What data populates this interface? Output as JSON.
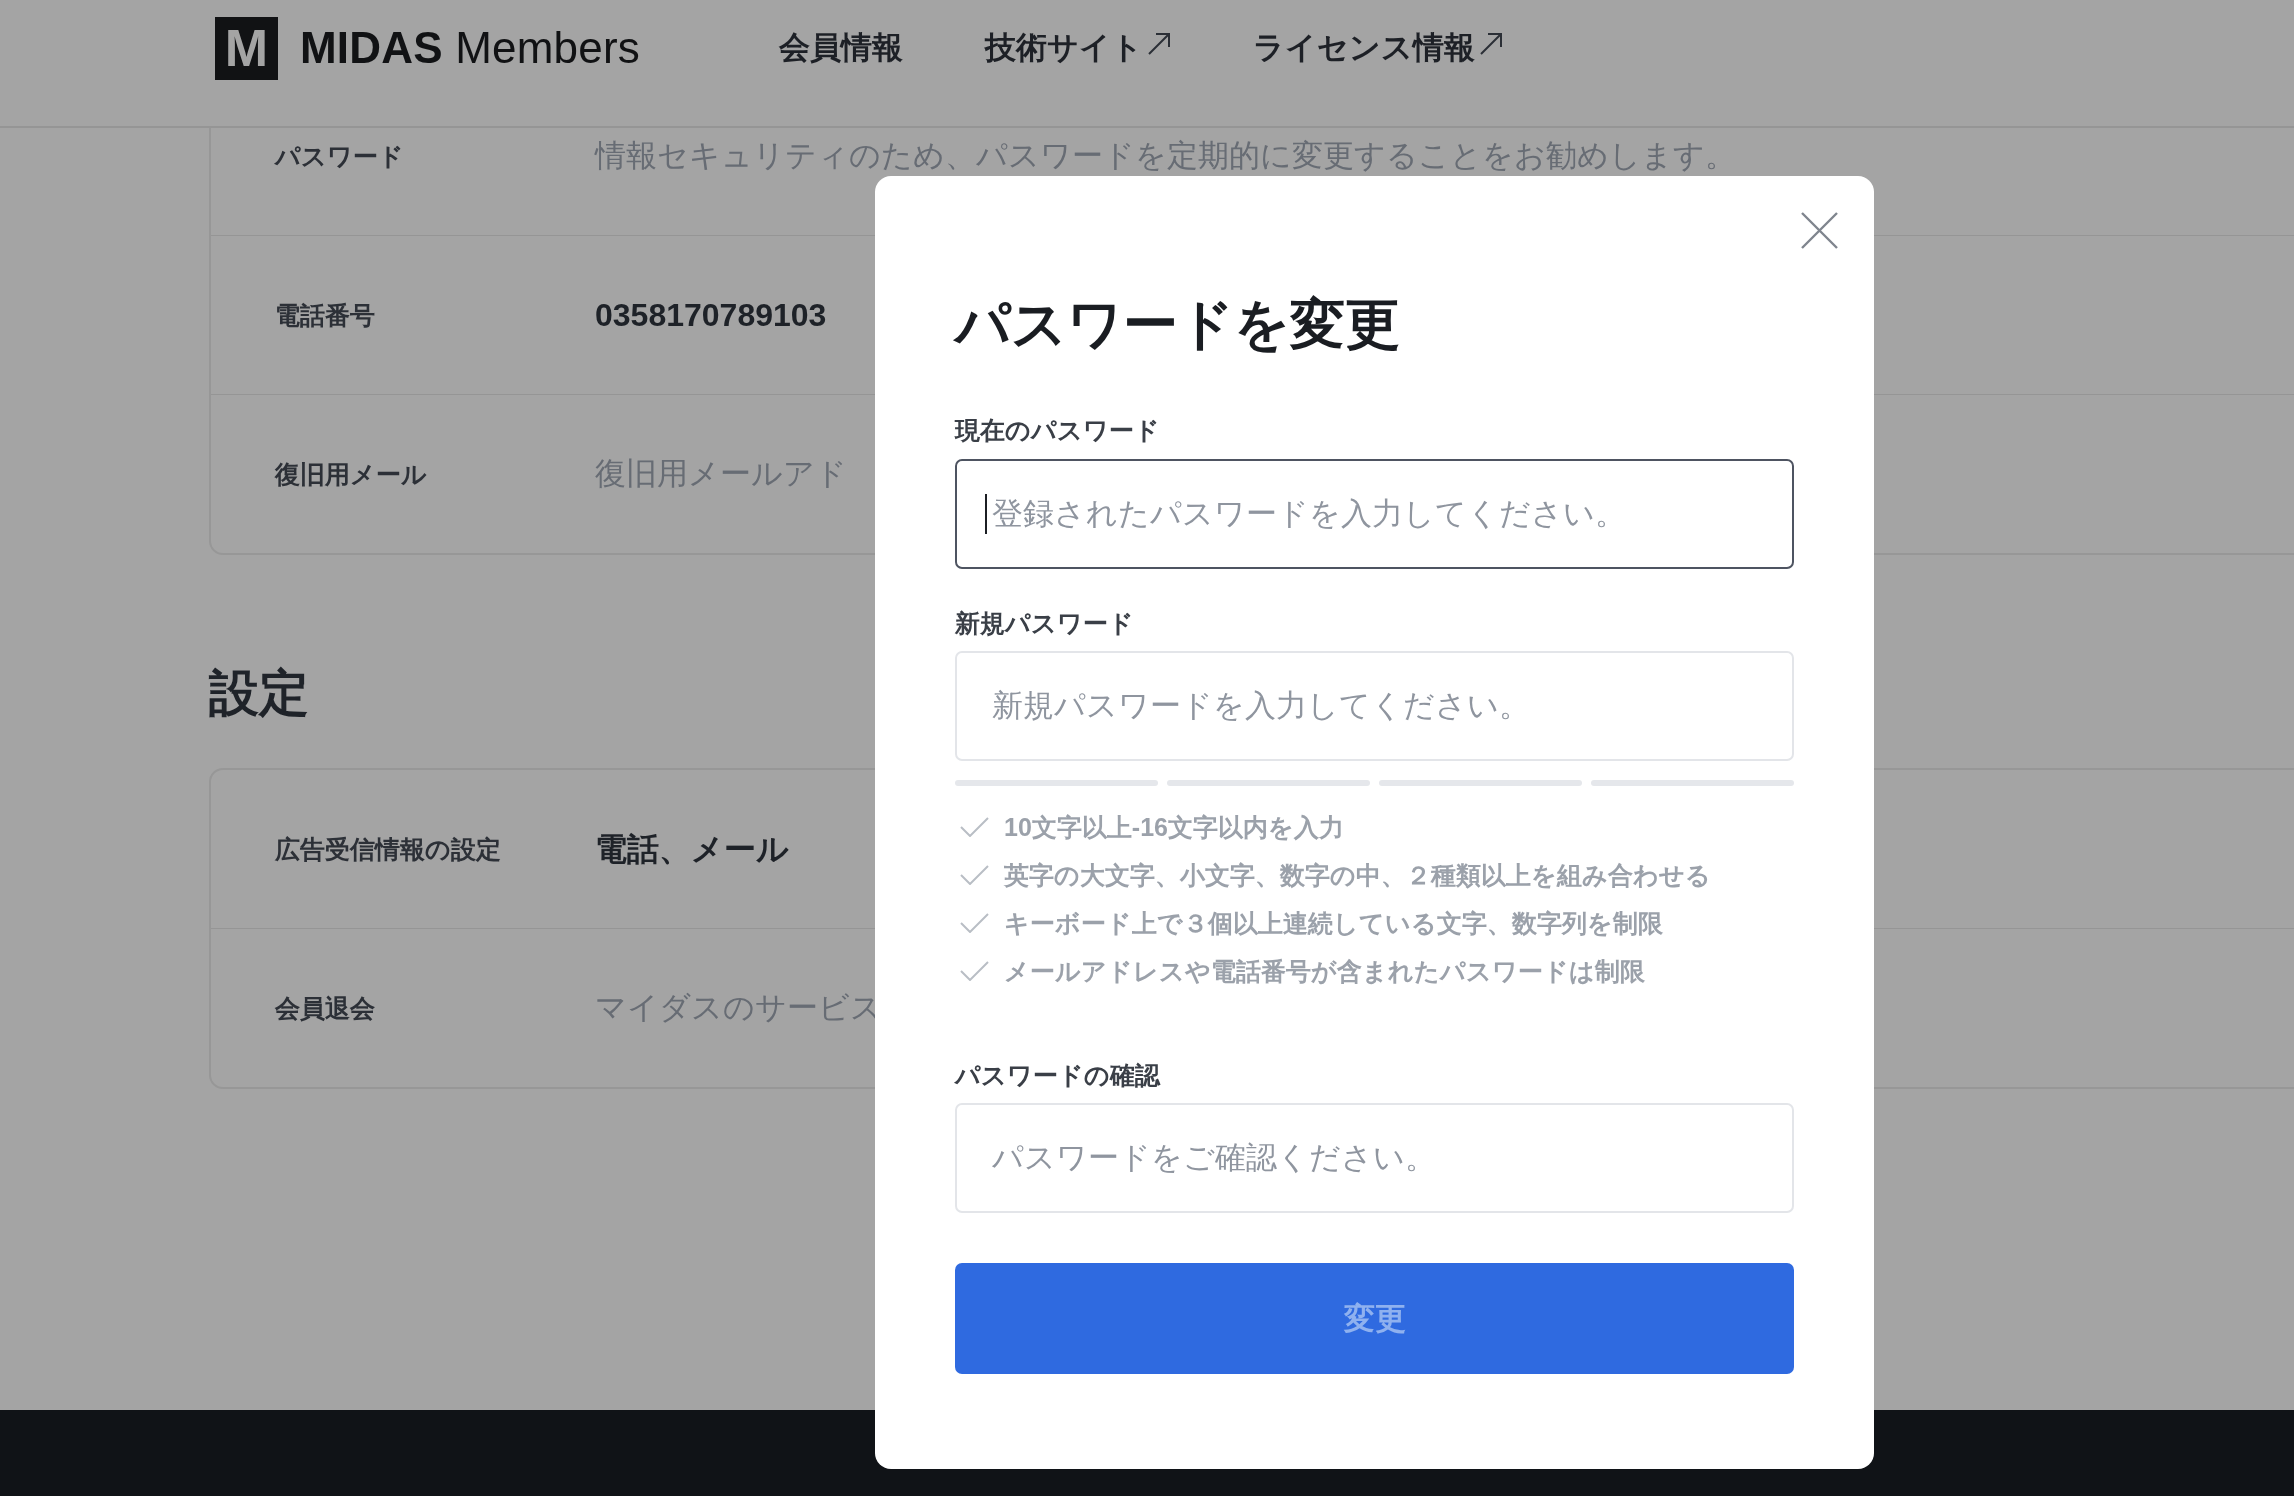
{
  "header": {
    "logo": {
      "mark": "M",
      "text": "**MIDAS** Members"
    },
    "nav": [
      {
        "label": "会員情報",
        "external": false
      },
      {
        "label": "技術サイト",
        "external": true
      },
      {
        "label": "ライセンス情報",
        "external": true
      }
    ]
  },
  "profile": {
    "rows": [
      {
        "label": "パスワード",
        "value": "情報セキュリティのため、パスワードを定期的に変更することをお勧めします。",
        "kind": "hint"
      },
      {
        "label": "電話番号",
        "value": "0358170789103",
        "kind": "value"
      },
      {
        "label": "復旧用メール",
        "value": "復旧用メールアド",
        "kind": "hint"
      }
    ]
  },
  "settings": {
    "title": "設定",
    "rows": [
      {
        "label": "広告受信情報の設定",
        "value": "電話、メール",
        "kind": "value"
      },
      {
        "label": "会員退会",
        "value": "マイダスのサービス",
        "kind": "hint"
      }
    ]
  },
  "dialog": {
    "title": "パスワードを変更",
    "fields": [
      {
        "label": "現在のパスワード",
        "placeholder": "登録されたパスワードを入力してください。",
        "focused": true
      },
      {
        "label": "新規パスワード",
        "placeholder": "新規パスワードを入力してください。",
        "focused": false,
        "requirements": [
          {
            "text": "10文字以上-16文字以内を入力",
            "met": false
          },
          {
            "text": "英字の大文字、小文字、数字の中、２種類以上を組み合わせる",
            "met": false
          },
          {
            "text": "キーボード上で３個以上連続している文字、数字列を制限",
            "met": false
          },
          {
            "text": "メールアドレスや電話番号が含まれたパスワードは制限",
            "met": false
          }
        ]
      },
      {
        "label": "パスワードの確認",
        "placeholder": "パスワードをご確認ください。",
        "focused": false
      }
    ],
    "submit": {
      "label": "変更",
      "disabled": true
    }
  }
}
